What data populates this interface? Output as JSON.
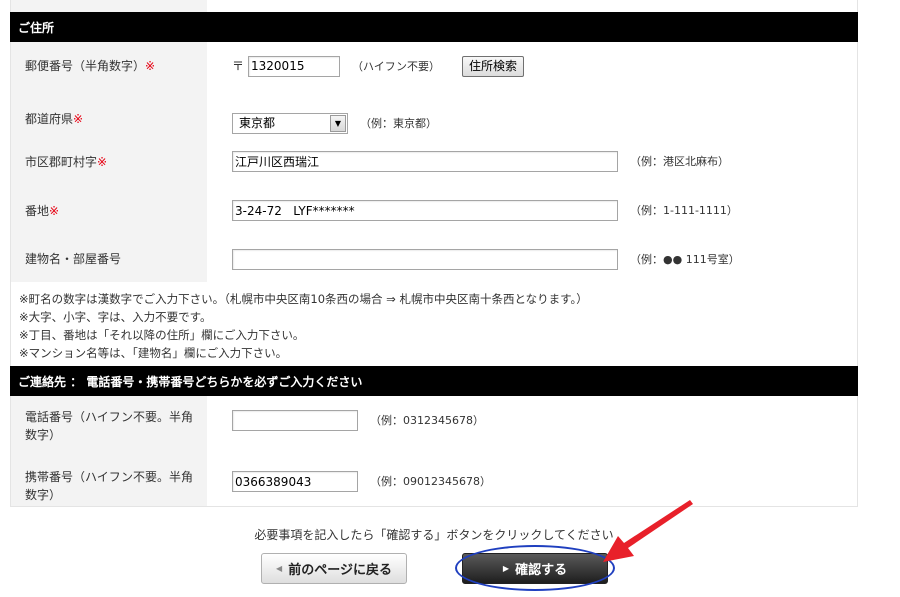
{
  "address_section": {
    "title": "ご住所",
    "zip": {
      "label": "郵便番号（半角数字）",
      "required_mark": "※",
      "prefix": "〒",
      "value": "1320015",
      "note": "（ハイフン不要）",
      "search_button": "住所検索"
    },
    "prefecture": {
      "label": "都道府県",
      "required_mark": "※",
      "selected": "東京都",
      "note": "（例：東京都）"
    },
    "city": {
      "label": "市区郡町村字",
      "required_mark": "※",
      "value": "江戸川区西瑞江",
      "note": "（例：港区北麻布）"
    },
    "street": {
      "label": "番地",
      "required_mark": "※",
      "value": "3-24-72   LYF*******",
      "note": "（例：1-111-1111）"
    },
    "building": {
      "label": "建物名・部屋番号",
      "value": "",
      "note": "（例：●● 111号室）"
    },
    "notes": [
      "※町名の数字は漢数字でご入力下さい。（札幌市中央区南10条西の場合 ⇒ 札幌市中央区南十条西となります。）",
      "※大字、小字、字は、入力不要です。",
      "※丁目、番地は「それ以降の住所」欄にご入力下さい。",
      "※マンション名等は、「建物名」欄にご入力下さい。"
    ]
  },
  "contact_section": {
    "title": "ご連絡先 ： 電話番号・携帯番号どちらかを必ずご入力ください",
    "phone": {
      "label": "電話番号（ハイフン不要。半角数字）",
      "value": "",
      "note": "（例：0312345678）"
    },
    "mobile": {
      "label": "携帯番号（ハイフン不要。半角数字）",
      "value": "0366389043",
      "note": "（例：09012345678）"
    }
  },
  "footer": {
    "instruction": "必要事項を記入したら「確認する」ボタンをクリックしてください",
    "back_button": "前のページに戻る",
    "confirm_button": "確認する"
  },
  "annotation": {
    "ellipse_color": "#1f3fbf",
    "arrow_color": "#e8202a"
  }
}
